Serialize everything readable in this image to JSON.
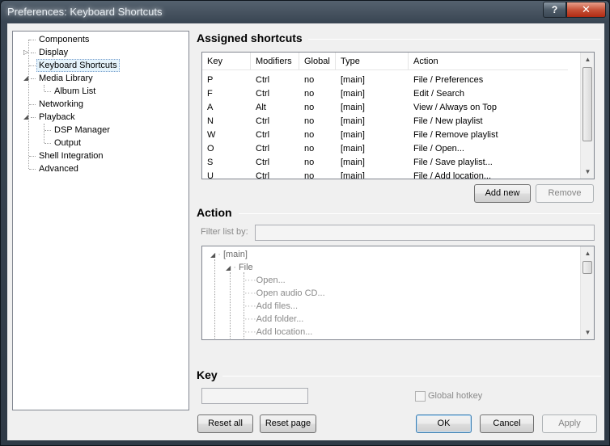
{
  "window": {
    "title": "Preferences: Keyboard Shortcuts",
    "help_label": "?",
    "close_label": "✕"
  },
  "nav_tree": {
    "items": [
      {
        "label": "Components",
        "level": 0,
        "expandable": false
      },
      {
        "label": "Display",
        "level": 0,
        "expandable": true,
        "expanded": false
      },
      {
        "label": "Keyboard Shortcuts",
        "level": 0,
        "expandable": false,
        "selected": true
      },
      {
        "label": "Media Library",
        "level": 0,
        "expandable": true,
        "expanded": true
      },
      {
        "label": "Album List",
        "level": 1,
        "expandable": false
      },
      {
        "label": "Networking",
        "level": 0,
        "expandable": false
      },
      {
        "label": "Playback",
        "level": 0,
        "expandable": true,
        "expanded": true
      },
      {
        "label": "DSP Manager",
        "level": 1,
        "expandable": false
      },
      {
        "label": "Output",
        "level": 1,
        "expandable": false
      },
      {
        "label": "Shell Integration",
        "level": 0,
        "expandable": false
      },
      {
        "label": "Advanced",
        "level": 0,
        "expandable": false
      }
    ]
  },
  "assigned": {
    "title": "Assigned shortcuts",
    "columns": [
      "Key",
      "Modifiers",
      "Global",
      "Type",
      "Action"
    ],
    "rows": [
      [
        "P",
        "Ctrl",
        "no",
        "[main]",
        "File / Preferences"
      ],
      [
        "F",
        "Ctrl",
        "no",
        "[main]",
        "Edit / Search"
      ],
      [
        "A",
        "Alt",
        "no",
        "[main]",
        "View / Always on Top"
      ],
      [
        "N",
        "Ctrl",
        "no",
        "[main]",
        "File / New playlist"
      ],
      [
        "W",
        "Ctrl",
        "no",
        "[main]",
        "File / Remove playlist"
      ],
      [
        "O",
        "Ctrl",
        "no",
        "[main]",
        "File / Open..."
      ],
      [
        "S",
        "Ctrl",
        "no",
        "[main]",
        "File / Save playlist..."
      ],
      [
        "U",
        "Ctrl",
        "no",
        "[main]",
        "File / Add location..."
      ]
    ],
    "add_new_label": "Add new",
    "remove_label": "Remove"
  },
  "action": {
    "title": "Action",
    "filter_label": "Filter list by:",
    "filter_value": "",
    "tree": {
      "root": "[main]",
      "group": "File",
      "items": [
        "Open...",
        "Open audio CD...",
        "Add files...",
        "Add folder...",
        "Add location..."
      ]
    }
  },
  "key": {
    "title": "Key",
    "key_value": "",
    "global_hotkey_label": "Global hotkey",
    "global_hotkey_checked": false
  },
  "footer": {
    "reset_all_label": "Reset all",
    "reset_page_label": "Reset page",
    "ok_label": "OK",
    "cancel_label": "Cancel",
    "apply_label": "Apply"
  }
}
